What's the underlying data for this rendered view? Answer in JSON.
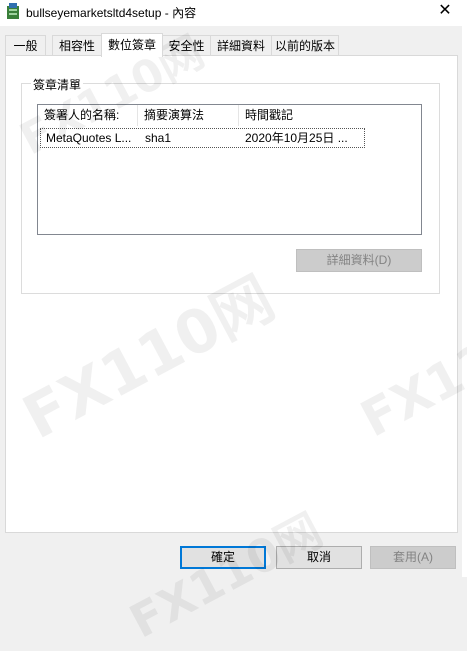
{
  "window": {
    "title": "bullseyemarketsltd4setup - 內容",
    "close_glyph": "✕",
    "app_icon": "installer-icon"
  },
  "tabs": [
    {
      "label": "一般",
      "active": false
    },
    {
      "label": "相容性",
      "active": false
    },
    {
      "label": "數位簽章",
      "active": true
    },
    {
      "label": "安全性",
      "active": false
    },
    {
      "label": "詳細資料",
      "active": false
    },
    {
      "label": "以前的版本",
      "active": false
    }
  ],
  "signature_group": {
    "label": "簽章清單",
    "columns": [
      "簽署人的名稱:",
      "摘要演算法",
      "時間戳記"
    ],
    "rows": [
      {
        "signer": "MetaQuotes L...",
        "algorithm": "sha1",
        "timestamp": "2020年10月25日 ..."
      }
    ],
    "details_button": "詳細資料(D)"
  },
  "footer": {
    "ok": "確定",
    "cancel": "取消",
    "apply": "套用(A)"
  },
  "watermark": {
    "text": "FX110网"
  },
  "colors": {
    "focus_border": "#0078d7",
    "disabled_text": "#838383"
  }
}
